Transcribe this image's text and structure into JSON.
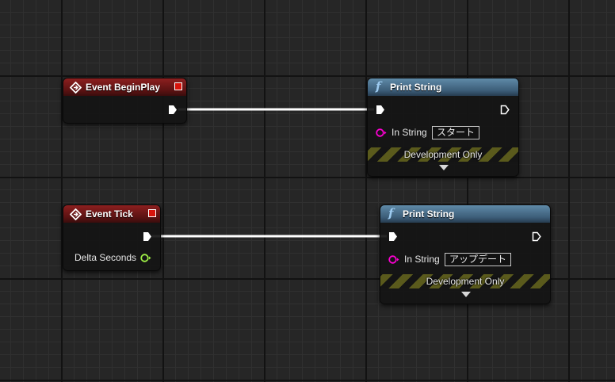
{
  "colors": {
    "event_header": "#8c1f1f",
    "function_header": "#3c5d78",
    "exec_wire": "#ffffff",
    "string_pin": "#ff00d4",
    "float_pin": "#9ff046",
    "delegate_pin": "#d8140c"
  },
  "nodes": {
    "begin_play": {
      "title": "Event BeginPlay",
      "icon": "event-diamond-icon"
    },
    "tick": {
      "title": "Event Tick",
      "icon": "event-diamond-icon",
      "delta_label": "Delta Seconds"
    },
    "print1": {
      "title": "Print String",
      "icon": "function-f-icon",
      "in_string_label": "In String",
      "in_string_value": "スタート",
      "footer": "Development Only"
    },
    "print2": {
      "title": "Print String",
      "icon": "function-f-icon",
      "in_string_label": "In String",
      "in_string_value": "アップデート",
      "footer": "Development Only"
    }
  }
}
